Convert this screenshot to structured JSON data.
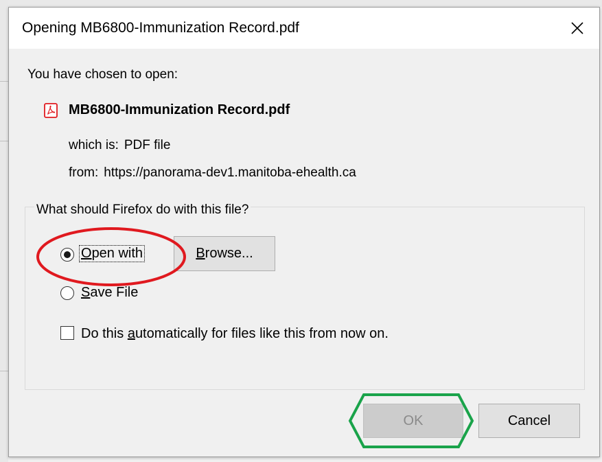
{
  "dialog": {
    "title": "Opening MB6800-Immunization Record.pdf"
  },
  "file": {
    "chosen_label": "You have chosen to open:",
    "name": "MB6800-Immunization Record.pdf",
    "which_key": "which is:",
    "which_value": "PDF file",
    "from_key": "from:",
    "from_value": "https://panorama-dev1.manitoba-ehealth.ca"
  },
  "action_group": {
    "legend": "What should Firefox do with this file?",
    "open_with": {
      "label": "Open with",
      "accel": "O",
      "rest": "pen with",
      "selected": true
    },
    "browse_button": {
      "accel": "B",
      "rest": "rowse..."
    },
    "save_file": {
      "accel": "S",
      "rest": "ave File",
      "selected": false
    },
    "auto_checkbox": {
      "before": "Do this ",
      "accel": "a",
      "after": "utomatically for files like this from now on.",
      "checked": false
    }
  },
  "buttons": {
    "ok": {
      "label": "OK",
      "enabled": false
    },
    "cancel": {
      "label": "Cancel"
    }
  },
  "annotations": {
    "red_ellipse_color": "#e0191f",
    "green_hexagon_color": "#1aa34a"
  },
  "icons": {
    "close": "close-icon",
    "pdf": "pdf-file-icon"
  }
}
